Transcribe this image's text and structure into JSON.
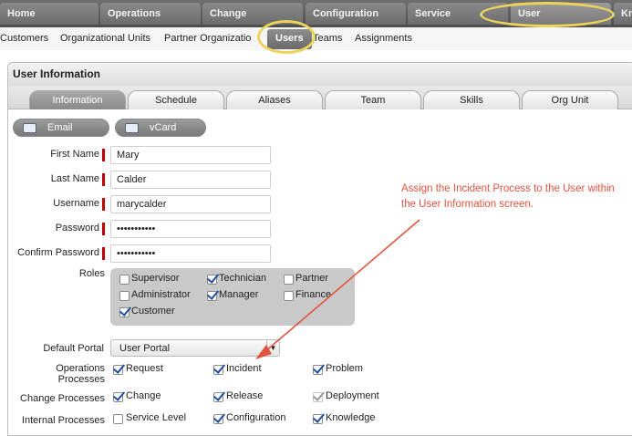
{
  "top_tabs": [
    {
      "label": "Home"
    },
    {
      "label": "Operations"
    },
    {
      "label": "Change"
    },
    {
      "label": "Configuration"
    },
    {
      "label": "Service"
    },
    {
      "label": "User"
    },
    {
      "label": "Kn"
    }
  ],
  "sub_nav": [
    {
      "label": "Customers"
    },
    {
      "label": "Organizational Units"
    },
    {
      "label": "Partner Organizatio"
    },
    {
      "label": "Users"
    },
    {
      "label": "Teams"
    },
    {
      "label": "Assignments"
    }
  ],
  "panel": {
    "title": "User Information",
    "tabs": [
      {
        "label": "Information"
      },
      {
        "label": "Schedule"
      },
      {
        "label": "Aliases"
      },
      {
        "label": "Team"
      },
      {
        "label": "Skills"
      },
      {
        "label": "Org Unit"
      }
    ],
    "email_button": "Email",
    "vcard_button": "vCard"
  },
  "form": {
    "first_name_label": "First Name",
    "first_name_value": "Mary",
    "last_name_label": "Last Name",
    "last_name_value": "Calder",
    "username_label": "Username",
    "username_value": "marycalder",
    "password_label": "Password",
    "password_value": "•••••••••••",
    "confirm_password_label": "Confirm Password",
    "confirm_password_value": "•••••••••••",
    "roles_label": "Roles",
    "roles": [
      {
        "label": "Supervisor",
        "checked": false
      },
      {
        "label": "Technician",
        "checked": true
      },
      {
        "label": "Partner",
        "checked": false
      },
      {
        "label": "Administrator",
        "checked": false
      },
      {
        "label": "Manager",
        "checked": true
      },
      {
        "label": "Finance",
        "checked": false
      },
      {
        "label": "Customer",
        "checked": true
      }
    ],
    "default_portal_label": "Default Portal",
    "default_portal_value": "User Portal",
    "operations_processes_label": "Operations Processes",
    "operations_processes": [
      {
        "label": "Request",
        "checked": true
      },
      {
        "label": "Incident",
        "checked": true
      },
      {
        "label": "Problem",
        "checked": true
      }
    ],
    "change_processes_label": "Change Processes",
    "change_processes": [
      {
        "label": "Change",
        "checked": true
      },
      {
        "label": "Release",
        "checked": true
      },
      {
        "label": "Deployment",
        "checked": true,
        "disabled": true
      }
    ],
    "internal_processes_label": "Internal Processes",
    "internal_processes": [
      {
        "label": "Service Level",
        "checked": false
      },
      {
        "label": "Configuration",
        "checked": true
      },
      {
        "label": "Knowledge",
        "checked": true
      }
    ]
  },
  "annotation": {
    "text": "Assign the Incident Process to the User within the User Information screen.",
    "color": "#e0533d"
  },
  "colors": {
    "highlight": "#ecd35a",
    "required_marker": "#b00000",
    "checkmark": "#1f4f9e"
  }
}
